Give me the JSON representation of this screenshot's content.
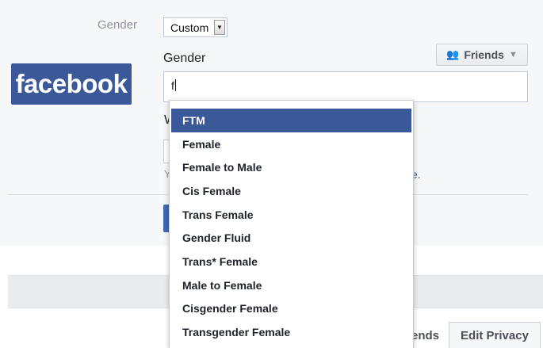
{
  "form": {
    "gender_label": "Gender",
    "select_value": "Custom",
    "gender_subtitle": "Gender",
    "input_value": "f",
    "hidden_w": "W",
    "hidden_y": "Y",
    "hidden_link": "e."
  },
  "brand": {
    "logo_text": "facebook",
    "color": "#3b5998"
  },
  "audience": {
    "label": "Friends",
    "icon": "friends-icon"
  },
  "dropdown": {
    "options": [
      "FTM",
      "Female",
      "Female to Male",
      "Cis Female",
      "Trans Female",
      "Gender Fluid",
      "Trans* Female",
      "Male to Female",
      "Cisgender Female",
      "Transgender Female"
    ],
    "selected_index": 0
  },
  "footer": {
    "friends_tab": "Friends",
    "edit_privacy": "Edit Privacy"
  }
}
